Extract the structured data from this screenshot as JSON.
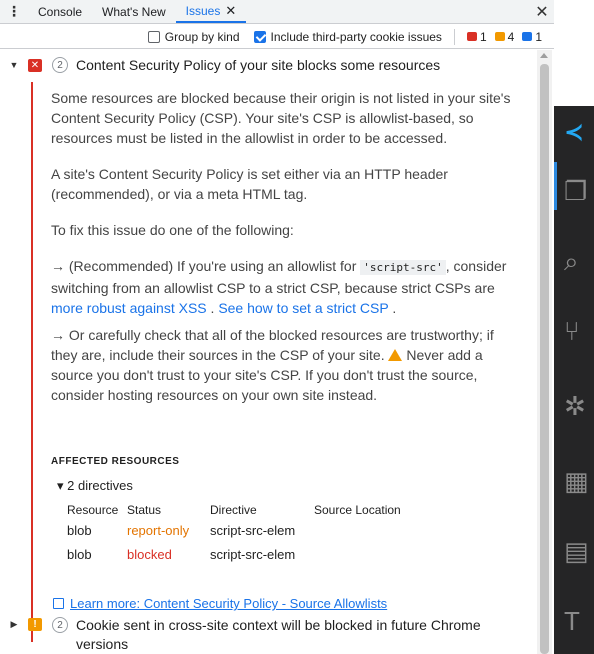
{
  "tabs": [
    {
      "label": "Console",
      "active": false
    },
    {
      "label": "What's New",
      "active": false
    },
    {
      "label": "Issues",
      "active": true
    }
  ],
  "toolbar": {
    "group_by_kind": {
      "label": "Group by kind",
      "checked": false
    },
    "third_party": {
      "label": "Include third-party cookie issues",
      "checked": true
    },
    "counts": {
      "errors": "1",
      "warnings": "4",
      "info": "1"
    }
  },
  "issue1": {
    "count": "2",
    "title": "Content Security Policy of your site blocks some resources",
    "p1": "Some resources are blocked because their origin is not listed in your site's Content Security Policy (CSP). Your site's CSP is allowlist-based, so resources must be listed in the allowlist in order to be accessed.",
    "p2": "A site's Content Security Policy is set either via an HTTP header (recommended), or via a meta HTML tag.",
    "p3": "To fix this issue do one of the following:",
    "p4_a": "→ (Recommended) If you're using an allowlist for ",
    "p4_code": "'script-src'",
    "p4_b": ", consider switching from an allowlist CSP to a strict CSP, because strict CSPs are ",
    "p4_link1": "more robust against XSS",
    "p4_sep": " . ",
    "p4_link2": "See how to set a strict CSP",
    "p4_end": " .",
    "p5_a": "→ Or carefully check that all of the blocked resources are trustworthy; if they are, include their sources in the CSP of your site. ",
    "p5_b": " Never add a source you don't trust to your site's CSP. If you don't trust the source, consider hosting resources on your own site instead.",
    "affected_title": "AFFECTED RESOURCES",
    "directives_toggle": "▾ 2 directives",
    "columns": [
      "Resource",
      "Status",
      "Directive",
      "Source Location"
    ],
    "rows": [
      {
        "resource": "blob",
        "status": "report-only",
        "directive": "script-src-elem"
      },
      {
        "resource": "blob",
        "status": "blocked",
        "directive": "script-src-elem"
      }
    ],
    "learn_more": "Learn more: Content Security Policy - Source Allowlists"
  },
  "issue2": {
    "count": "2",
    "title": "Cookie sent in cross-site context will be blocked in future Chrome versions"
  }
}
